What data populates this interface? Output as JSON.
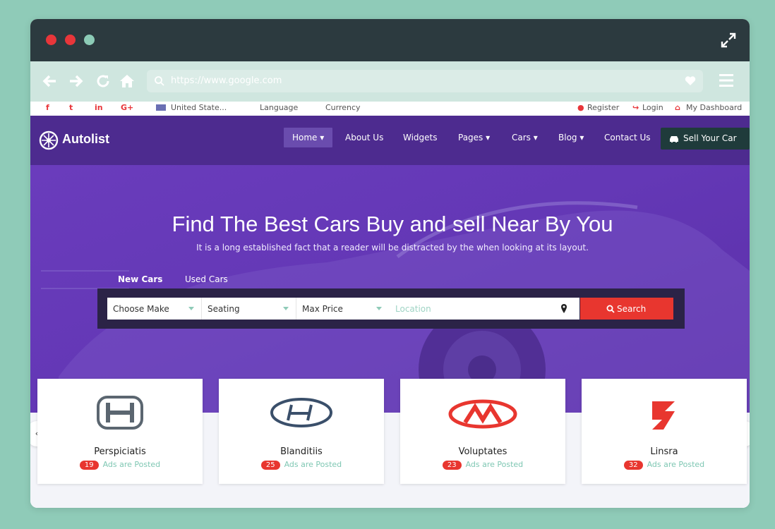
{
  "browser": {
    "url": "https://www.google.com"
  },
  "topbar": {
    "social": [
      "f",
      "t",
      "in",
      "G+"
    ],
    "country": "United State...",
    "language": "Language",
    "currency": "Currency",
    "register": "Register",
    "login": "Login",
    "dashboard": "My Dashboard"
  },
  "navbar": {
    "brand": "Autolist",
    "menu": [
      "Home",
      "About Us",
      "Widgets",
      "Pages",
      "Cars",
      "Blog",
      "Contact Us"
    ],
    "sell_button": "Sell Your Car"
  },
  "hero": {
    "title": "Find The Best Cars Buy and sell Near By You",
    "subtitle": "It is a long established fact that a reader will be distracted by the when looking at its layout.",
    "tabs": [
      "New Cars",
      "Used Cars"
    ],
    "search": {
      "make": "Choose Make",
      "seating": "Seating",
      "max_price": "Max Price",
      "location_placeholder": "Location",
      "button": "Search"
    }
  },
  "brands": [
    {
      "name": "Perspiciatis",
      "count": "19",
      "label": "Ads are Posted"
    },
    {
      "name": "Blanditiis",
      "count": "25",
      "label": "Ads are Posted"
    },
    {
      "name": "Voluptates",
      "count": "23",
      "label": "Ads are Posted"
    },
    {
      "name": "Linsra",
      "count": "32",
      "label": "Ads are Posted"
    }
  ],
  "colors": {
    "accent_red": "#e8362f",
    "brand_purple": "#4d2b8f",
    "hero_purple": "#6438b6",
    "mint": "#8fcbb8"
  }
}
